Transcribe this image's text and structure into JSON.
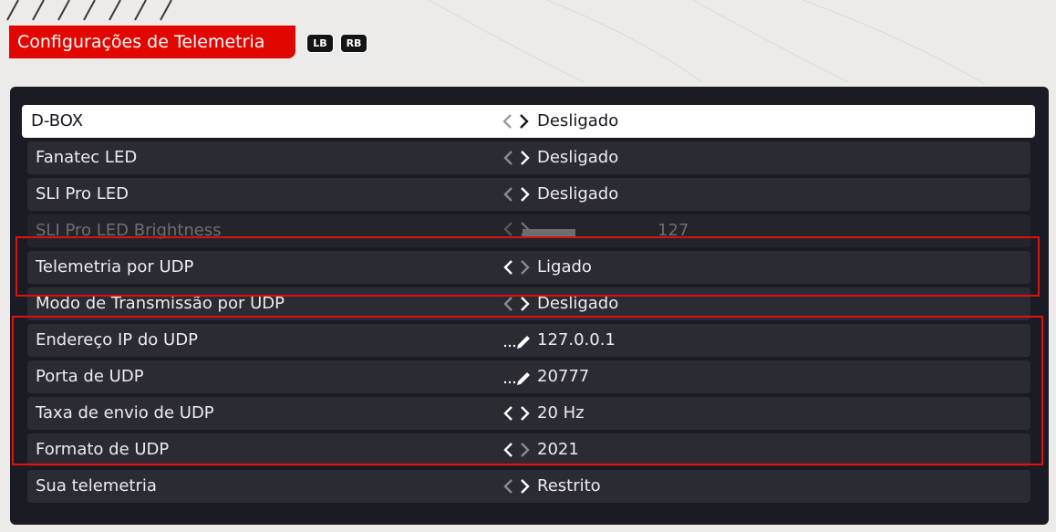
{
  "header": {
    "title": "Configurações de Telemetria"
  },
  "bumpers": {
    "left": "LB",
    "right": "RB"
  },
  "colors": {
    "accent": "#e10600",
    "panel": "#1b1b23",
    "row": "#2b2b33",
    "selected_row": "#ffffff",
    "highlight_box": "#e11010"
  },
  "settings": [
    {
      "label": "D-BOX",
      "value": "Desligado",
      "control": "arrows"
    },
    {
      "label": "Fanatec LED",
      "value": "Desligado",
      "control": "arrows"
    },
    {
      "label": "SLI Pro LED",
      "value": "Desligado",
      "control": "arrows"
    },
    {
      "label": "SLI Pro LED Brightness",
      "value": "127",
      "control": "slider",
      "fill_fraction": 0.48
    },
    {
      "label": "Telemetria por UDP",
      "value": "Ligado",
      "control": "arrows"
    },
    {
      "label": "Modo de Transmissão por UDP",
      "value": "Desligado",
      "control": "arrows"
    },
    {
      "label": "Endereço IP do UDP",
      "value": "127.0.0.1",
      "control": "edit"
    },
    {
      "label": "Porta de UDP",
      "value": "20777",
      "control": "edit"
    },
    {
      "label": "Taxa de envio de UDP",
      "value": "20 Hz",
      "control": "arrows"
    },
    {
      "label": "Formato de UDP",
      "value": "2021",
      "control": "arrows"
    },
    {
      "label": "Sua telemetria",
      "value": "Restrito",
      "control": "arrows"
    }
  ],
  "icons": {
    "arrow_left": "chevron-left-icon",
    "arrow_right": "chevron-right-icon",
    "edit": "pencil-icon"
  }
}
